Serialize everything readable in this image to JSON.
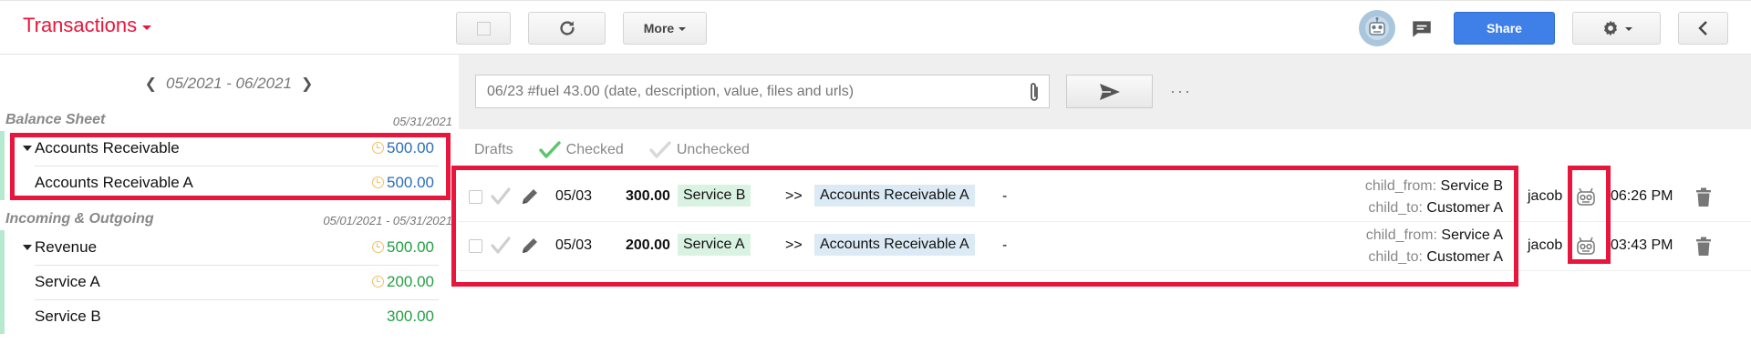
{
  "header": {
    "title": "Transactions",
    "more_label": "More",
    "share_label": "Share"
  },
  "sidebar": {
    "date_range": "05/2021 - 06/2021",
    "sections": [
      {
        "title": "Balance Sheet",
        "date": "05/31/2021",
        "accounts": [
          {
            "label": "Accounts Receivable",
            "value": "500.00"
          },
          {
            "label": "Accounts Receivable A",
            "value": "500.00"
          }
        ]
      },
      {
        "title": "Incoming & Outgoing",
        "date": "05/01/2021 - 05/31/2021",
        "accounts": [
          {
            "label": "Revenue",
            "value": "500.00"
          },
          {
            "label": "Service A",
            "value": "200.00"
          },
          {
            "label": "Service B",
            "value": "300.00"
          }
        ]
      }
    ]
  },
  "input": {
    "placeholder": "06/23 #fuel 43.00 (date, description, value, files and urls)"
  },
  "filters": {
    "drafts": "Drafts",
    "checked": "Checked",
    "unchecked": "Unchecked"
  },
  "transactions": [
    {
      "date": "05/03",
      "amount": "300.00",
      "from": "Service B",
      "arrow": ">>",
      "to": "Accounts Receivable A",
      "description": "-",
      "meta_from_key": "child_from:",
      "meta_from_val": "Service B",
      "meta_to_key": "child_to:",
      "meta_to_val": "Customer A",
      "user": "jacob",
      "time": "06:26 PM"
    },
    {
      "date": "05/03",
      "amount": "200.00",
      "from": "Service A",
      "arrow": ">>",
      "to": "Accounts Receivable A",
      "description": "-",
      "meta_from_key": "child_from:",
      "meta_from_val": "Service A",
      "meta_to_key": "child_to:",
      "meta_to_val": "Customer A",
      "user": "jacob",
      "time": "03:43 PM"
    }
  ],
  "colors": {
    "accent": "#e8163c",
    "share": "#3f7fe8",
    "positive": "#22a043",
    "balance": "#2a6ebb"
  }
}
